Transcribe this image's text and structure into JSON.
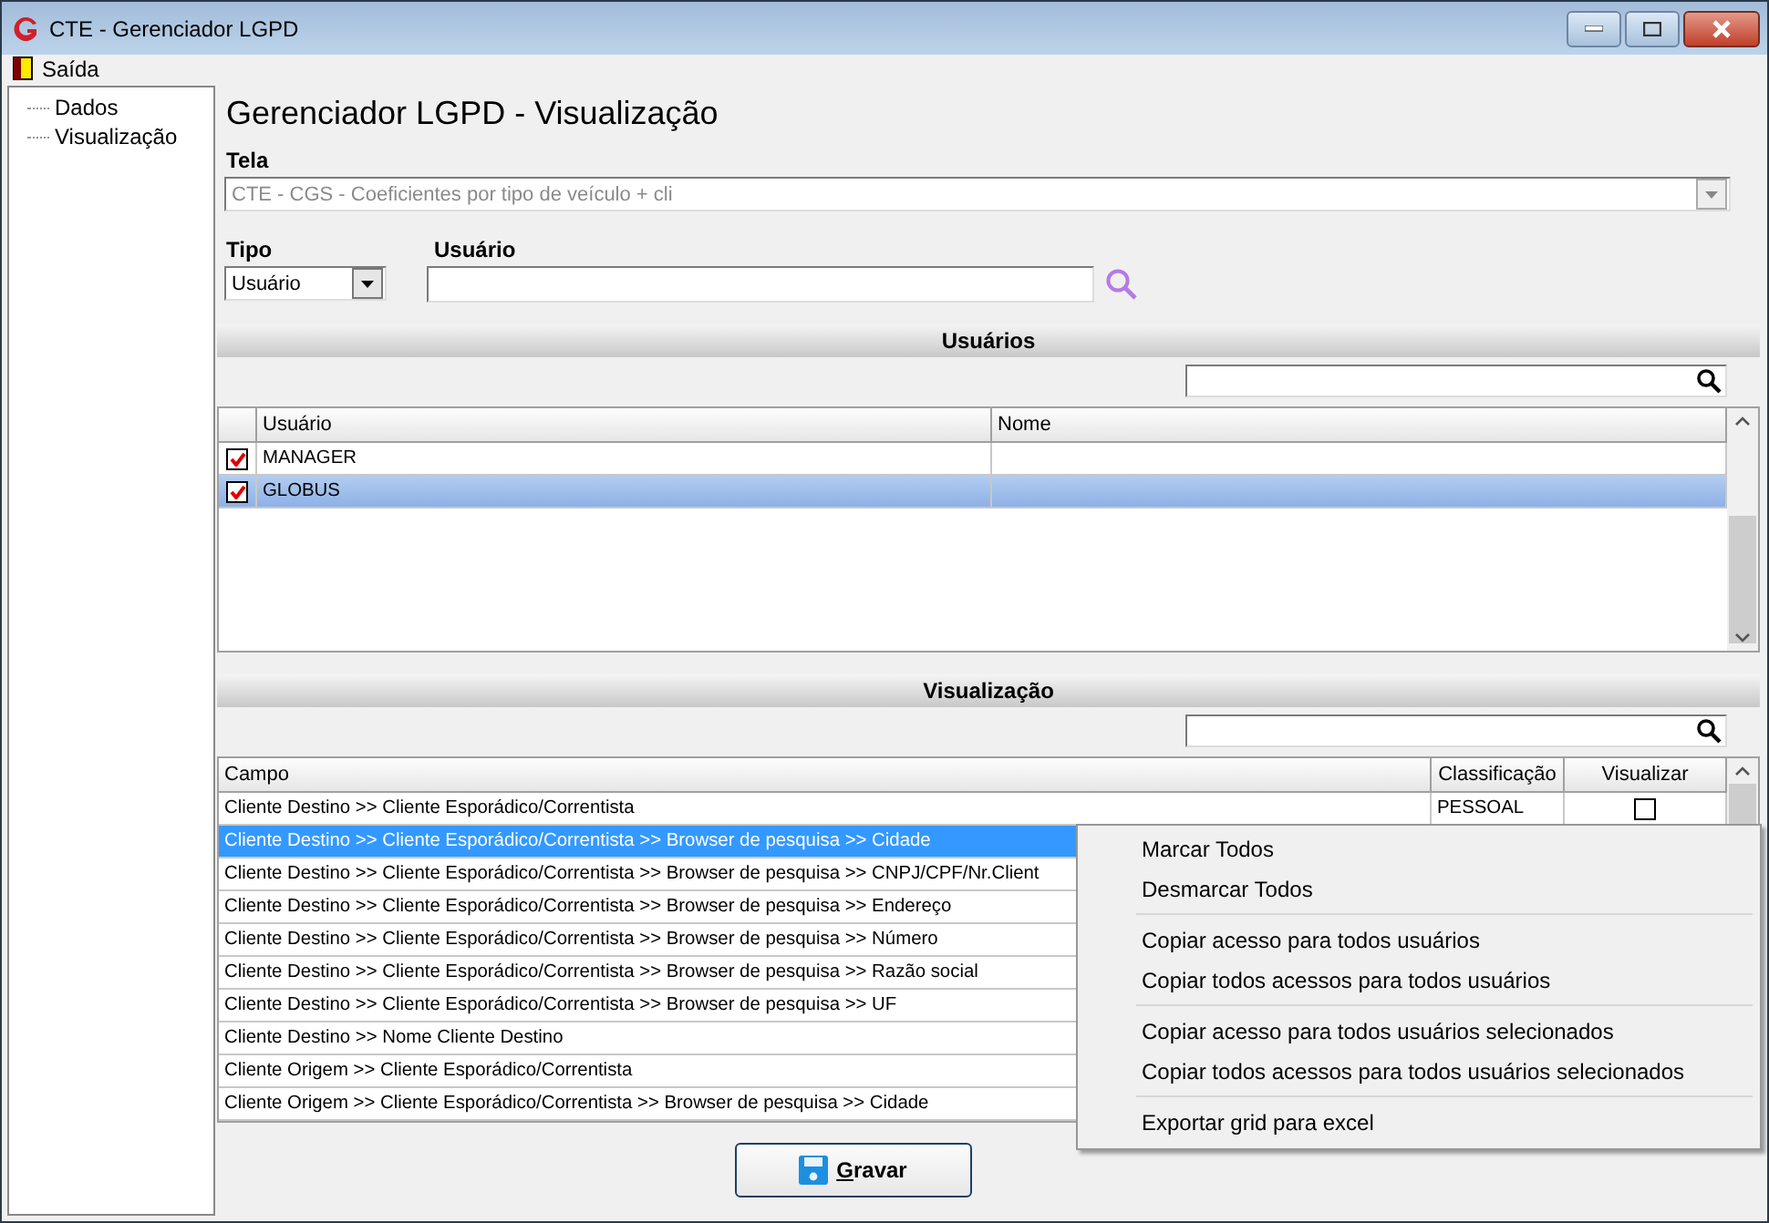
{
  "window": {
    "title": "CTE - Gerenciador LGPD"
  },
  "menu": [
    {
      "label": "Saída"
    }
  ],
  "sidebar": {
    "items": [
      {
        "label": "Dados",
        "selected": false
      },
      {
        "label": "Visualização",
        "selected": false
      }
    ]
  },
  "heading": "Gerenciador LGPD - Visualização",
  "tela": {
    "label": "Tela",
    "value": "CTE - CGS - Coeficientes por tipo de veículo + cli",
    "disabled": true
  },
  "tipo": {
    "label": "Tipo",
    "value": "Usuário"
  },
  "usuario": {
    "label": "Usuário"
  },
  "users": {
    "title": "Usuários",
    "columns": [
      "Usuário",
      "Nome"
    ],
    "rows": [
      {
        "usuario": "MANAGER",
        "checked": true,
        "selected": false
      },
      {
        "usuario": "GLOBUS",
        "checked": true,
        "selected": true
      }
    ]
  },
  "visualizacao": {
    "title": "Visualização",
    "columns": [
      "Campo",
      "Classificação",
      "Visualizar"
    ],
    "rows": [
      {
        "campo": "Cliente Destino >> Cliente Esporádico/Correntista",
        "classificacao": "PESSOAL",
        "visualizar": false,
        "selected": false
      },
      {
        "campo": "Cliente Destino >> Cliente Esporádico/Correntista >> Browser de pesquisa >> Cidade",
        "selected": true
      },
      {
        "campo": "Cliente Destino >> Cliente Esporádico/Correntista >> Browser de pesquisa >> CNPJ/CPF/Nr.Client",
        "selected": false
      },
      {
        "campo": "Cliente Destino >> Cliente Esporádico/Correntista >> Browser de pesquisa >> Endereço",
        "selected": false
      },
      {
        "campo": "Cliente Destino >> Cliente Esporádico/Correntista >> Browser de pesquisa >> Número",
        "selected": false
      },
      {
        "campo": "Cliente Destino >> Cliente Esporádico/Correntista >> Browser de pesquisa >> Razão social",
        "selected": false
      },
      {
        "campo": "Cliente Destino >> Cliente Esporádico/Correntista >> Browser de pesquisa >> UF",
        "selected": false
      },
      {
        "campo": "Cliente Destino >> Nome Cliente Destino",
        "selected": false
      },
      {
        "campo": "Cliente Origem >> Cliente Esporádico/Correntista",
        "selected": false
      },
      {
        "campo": "Cliente Origem >> Cliente Esporádico/Correntista >> Browser de pesquisa >> Cidade",
        "selected": false
      }
    ]
  },
  "context_menu": {
    "groups": [
      [
        "Marcar Todos",
        "Desmarcar Todos"
      ],
      [
        "Copiar acesso para todos usuários",
        "Copiar todos acessos para todos usuários"
      ],
      [
        "Copiar acesso para todos usuários selecionados",
        "Copiar todos acessos para todos usuários selecionados"
      ],
      [
        "Exportar grid para excel"
      ]
    ]
  },
  "save_button": {
    "label": "Gravar"
  }
}
